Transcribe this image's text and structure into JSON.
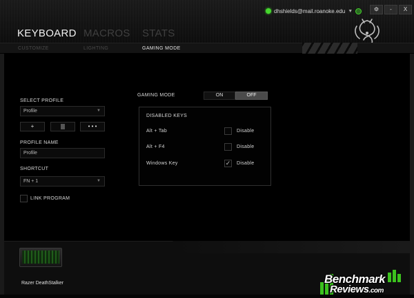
{
  "header": {
    "tabs": [
      {
        "label": "KEYBOARD",
        "active": true
      },
      {
        "label": "MACROS",
        "active": false
      },
      {
        "label": "STATS",
        "active": false
      }
    ],
    "account_email": "dhshields@mail.roanoke.edu",
    "controls": {
      "settings": "⚙",
      "minimize": "-",
      "close": "X"
    }
  },
  "subtabs": [
    {
      "label": "CUSTOMIZE",
      "active": false
    },
    {
      "label": "LIGHTING",
      "active": false
    },
    {
      "label": "GAMING MODE",
      "active": true
    }
  ],
  "left_panel": {
    "select_profile_label": "SELECT PROFILE",
    "profile_selected": "Profile",
    "buttons": {
      "add": "+",
      "delete": "🗑",
      "more": "• • •"
    },
    "profile_name_label": "PROFILE NAME",
    "profile_name_value": "Profile",
    "shortcut_label": "SHORTCUT",
    "shortcut_value": "FN + 1",
    "link_program_label": "LINK PROGRAM",
    "link_program_checked": false
  },
  "gaming_mode": {
    "label": "GAMING MODE",
    "on_label": "ON",
    "off_label": "OFF",
    "state": "off",
    "disabled_keys": {
      "title": "DISABLED KEYS",
      "items": [
        {
          "key": "Alt + Tab",
          "action": "Disable",
          "checked": false
        },
        {
          "key": "Alt + F4",
          "action": "Disable",
          "checked": false
        },
        {
          "key": "Windows Key",
          "action": "Disable",
          "checked": true
        }
      ]
    }
  },
  "footer": {
    "device_name": "Razer DeathStalker"
  },
  "watermark": {
    "line1": "Benchmark",
    "line2": "Reviews",
    "suffix": ".com"
  },
  "colors": {
    "accent_green": "#44d62c",
    "background": "#000000",
    "panel": "#0e0e0e"
  }
}
